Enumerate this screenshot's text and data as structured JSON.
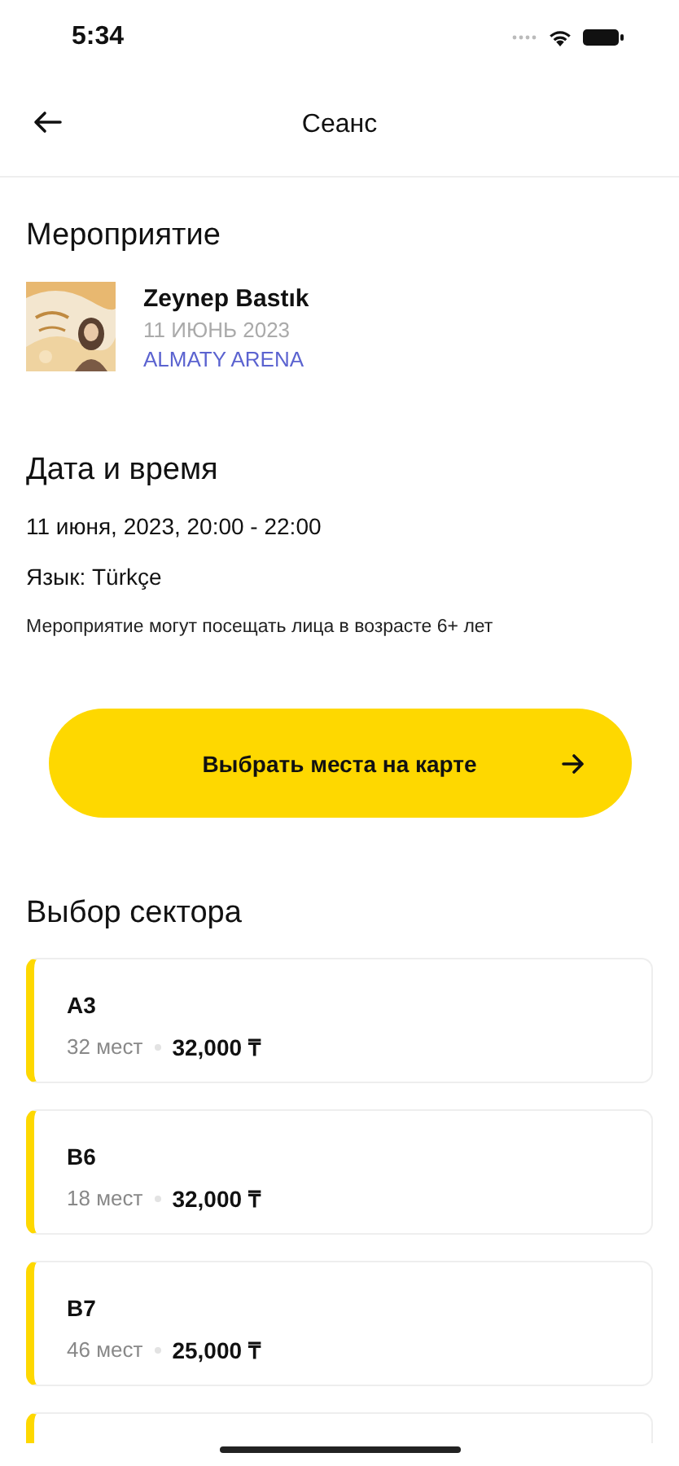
{
  "status_bar": {
    "time": "5:34"
  },
  "header": {
    "title": "Сеанс"
  },
  "event": {
    "heading": "Мероприятие",
    "name": "Zeynep Bastık",
    "date": "11 ИЮНЬ 2023",
    "venue": "ALMATY ARENA"
  },
  "schedule": {
    "heading": "Дата и время",
    "datetime": "11 июня, 2023, 20:00 - 22:00",
    "language": "Язык: Türkçe",
    "age_note": "Мероприятие могут посещать лица в возрасте 6+ лет"
  },
  "map_button": {
    "label": "Выбрать места на карте"
  },
  "sectors": {
    "heading": "Выбор сектора",
    "items": [
      {
        "kind": "full",
        "name": "A3",
        "seats": "32 мест",
        "price": "32,000 ₸"
      },
      {
        "kind": "full",
        "name": "B6",
        "seats": "18 мест",
        "price": "32,000 ₸"
      },
      {
        "kind": "full",
        "name": "B7",
        "seats": "46 мест",
        "price": "25,000 ₸"
      },
      {
        "kind": "cut_off"
      }
    ]
  }
}
